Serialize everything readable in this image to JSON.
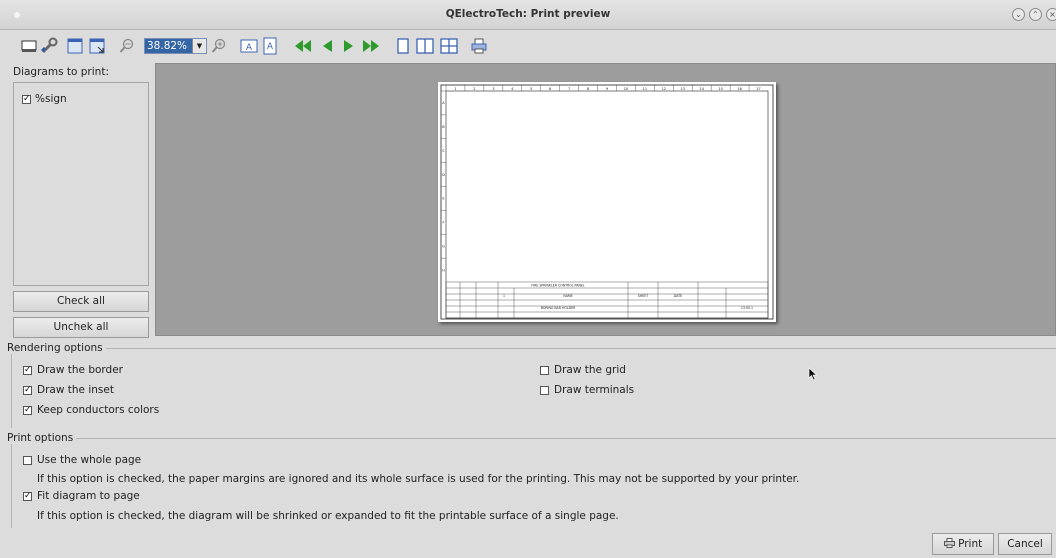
{
  "window": {
    "title": "QElectroTech: Print preview"
  },
  "toolbar": {
    "zoom_value": "38.82%",
    "icons": [
      "page-setup-icon",
      "printer-settings-icon",
      "fit-width-icon",
      "fit-page-icon",
      "zoom-out-icon",
      "zoom-combo",
      "zoom-in-icon",
      "portrait-icon",
      "landscape-icon",
      "first-page-icon",
      "previous-page-icon",
      "next-page-icon",
      "last-page-icon",
      "single-page-icon",
      "facing-pages-icon",
      "overview-pages-icon",
      "print-icon"
    ]
  },
  "left_panel": {
    "label": "Diagrams to print:",
    "diagrams": [
      {
        "label": "%sign",
        "checked": true
      }
    ],
    "check_all": "Check all",
    "uncheck_all": "Unchek all"
  },
  "sheet": {
    "ruler_columns": [
      "1",
      "2",
      "3",
      "4",
      "5",
      "6",
      "7",
      "8",
      "9",
      "10",
      "11",
      "12",
      "13",
      "14",
      "15",
      "16",
      "17"
    ],
    "ruler_rows": [
      "A",
      "B",
      "C",
      "D",
      "E",
      "F",
      "G",
      "H"
    ],
    "title_block": {
      "top_line": "FIRE SPRINKLER CONTROL PANEL",
      "part_label": "BORING BAR HOLDER",
      "cell_a": "1",
      "cell_b": "NAME",
      "cell_c": "SHEET",
      "cell_d": "DATE",
      "cell_e": "13.05.1"
    }
  },
  "rendering_options": {
    "title": "Rendering options",
    "items": [
      {
        "label": "Draw the border",
        "checked": true
      },
      {
        "label": "Draw the inset",
        "checked": true
      },
      {
        "label": "Keep conductors colors",
        "checked": true
      },
      {
        "label": "Draw the grid",
        "checked": false
      },
      {
        "label": "Draw terminals",
        "checked": false
      }
    ]
  },
  "print_options": {
    "title": "Print options",
    "whole_page": {
      "label": "Use the whole page",
      "checked": false,
      "description": "If this option is checked, the paper margins are ignored and its whole surface is used for the printing. This may not be supported by your printer."
    },
    "fit_page": {
      "label": "Fit diagram to page",
      "checked": true,
      "description": "If this option is checked, the diagram will be shrinked or expanded to fit the printable surface of a single page."
    }
  },
  "footer": {
    "print": "Print",
    "cancel": "Cancel"
  },
  "colors": {
    "accent": "#3465a4",
    "preview_bg": "#9d9d9d",
    "arrow_green": "#2e9a2e",
    "icon_blue": "#3c64b4"
  }
}
